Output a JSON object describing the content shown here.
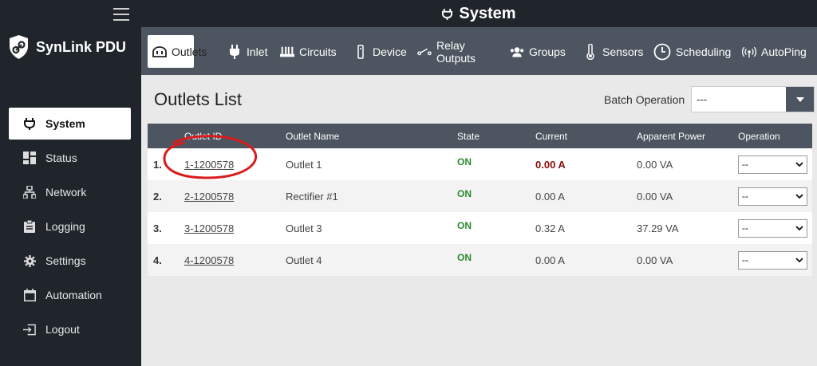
{
  "app": {
    "brand": "SynLink PDU",
    "header_title": "System"
  },
  "sidebar": {
    "items": [
      {
        "label": "System",
        "icon": "plug-icon",
        "active": true
      },
      {
        "label": "Status",
        "icon": "dashboard-icon",
        "active": false
      },
      {
        "label": "Network",
        "icon": "network-icon",
        "active": false
      },
      {
        "label": "Logging",
        "icon": "clipboard-icon",
        "active": false
      },
      {
        "label": "Settings",
        "icon": "gear-icon",
        "active": false
      },
      {
        "label": "Automation",
        "icon": "calendar-icon",
        "active": false
      },
      {
        "label": "Logout",
        "icon": "logout-icon",
        "active": false
      }
    ]
  },
  "tabs": [
    {
      "label": "Outlets",
      "icon": "outlet-icon",
      "active": true
    },
    {
      "label": "Inlet",
      "icon": "plug-icon"
    },
    {
      "label": "Circuits",
      "icon": "circuits-icon"
    },
    {
      "label": "Device",
      "icon": "device-icon"
    },
    {
      "label": "Relay Outputs",
      "icon": "relay-icon"
    },
    {
      "label": "Groups",
      "icon": "groups-icon"
    },
    {
      "label": "Sensors",
      "icon": "thermometer-icon"
    },
    {
      "label": "Scheduling",
      "icon": "clock-icon"
    },
    {
      "label": "AutoPing",
      "icon": "wireless-icon"
    }
  ],
  "main": {
    "title": "Outlets List",
    "batch_label": "Batch Operation",
    "batch_value": "---",
    "columns": [
      "Outlet ID",
      "Outlet Name",
      "State",
      "Current",
      "Apparent Power",
      "Operation"
    ],
    "rows": [
      {
        "num": "1.",
        "id": "1-1200578",
        "name": "Outlet 1",
        "state": "ON",
        "current": "0.00 A",
        "power": "0.00 VA",
        "op": "--"
      },
      {
        "num": "2.",
        "id": "2-1200578",
        "name": "Rectifier #1",
        "state": "ON",
        "current": "0.00 A",
        "power": "0.00 VA",
        "op": "--"
      },
      {
        "num": "3.",
        "id": "3-1200578",
        "name": "Outlet 3",
        "state": "ON",
        "current": "0.32 A",
        "power": "37.29 VA",
        "op": "--"
      },
      {
        "num": "4.",
        "id": "4-1200578",
        "name": "Outlet 4",
        "state": "ON",
        "current": "0.00 A",
        "power": "0.00 VA",
        "op": "--"
      }
    ]
  },
  "colors": {
    "sidebar_bg": "#1f252b",
    "tabbar_bg": "#4d5660",
    "state_on": "#2e8b2e",
    "current_alert": "#8b0a0a",
    "annotation": "#d91c1c"
  }
}
